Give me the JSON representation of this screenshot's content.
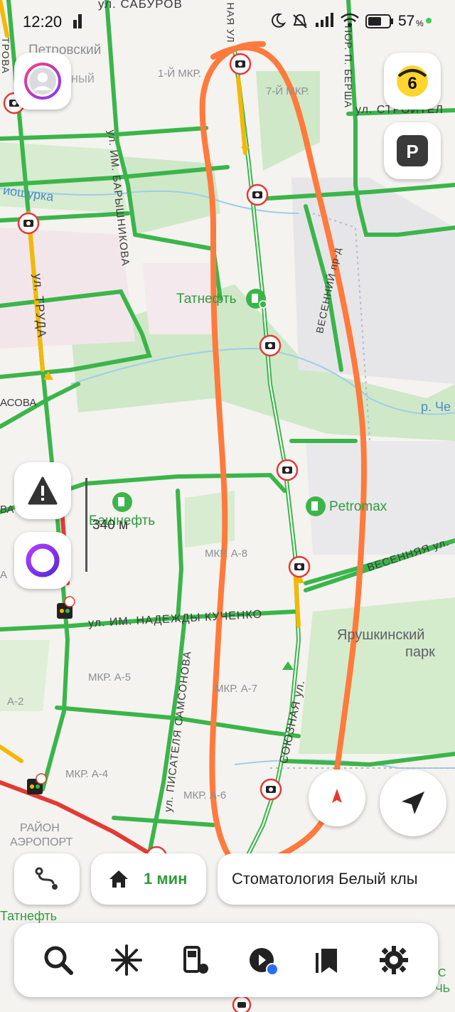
{
  "status_bar": {
    "time": "12:20",
    "battery": "57"
  },
  "weather_badge": {
    "value": "6"
  },
  "scale": {
    "label": "340 м"
  },
  "map_labels": {
    "petrovsky": "Петровский",
    "mkr1": "1-Й МКР.",
    "mkr7": "7-Й МКР.",
    "tatneft_top": "Татнефть",
    "bashneft": "Башнефть",
    "petromax": "Petromax",
    "a8": "МКР. А-8",
    "a5": "МКР. А-5",
    "a7": "МКР. А-7",
    "a4": "МКР. А-4",
    "a6": "МКР. А-6",
    "a2": "А-2",
    "airport_1": "РАЙОН",
    "airport_2": "АЭРОПОРТ",
    "park_1": "Ярушкинский",
    "park_2": "парк",
    "river1": "иошурка",
    "river2": "р. Че",
    "tatneft_bottom": "Татнефть",
    "noisy": "ный",
    "a_left": "А",
    "vsa": "ВА",
    "asova": "АСОВА",
    "s_bottom": "С",
    "ch_bottom": "ЧЬ"
  },
  "streets": {
    "saburova": "ул. САБУРОВ",
    "barshnikova": "ул. ИМ. БАРЫШНИКОВА",
    "truda": "ул. ТРУДА",
    "stroitel": "ул. СТРОИТЕЛ",
    "berсha": "ПОР. П. БЕРША",
    "vesenniy": "ВЕСЕННИЙ пр-д",
    "kuchenko": "ул. ИМ. НАДЕЖДЫ КУЧЕНКО",
    "samsonova": "ул. ПИСАТЕЛЯ САМСОНОВА",
    "soyuznaya": "СОЮЗНАЯ ул.",
    "vesennyaya": "ВЕСЕННЯЯ ул.",
    "naya": "НАЯ УЛ",
    "trova": "ТРОВА"
  },
  "route": {
    "time": "1 мин",
    "destination": "Стоматология Белый клы"
  },
  "colors": {
    "route_highlight": "#ff7a3c",
    "traffic_green": "#3bb54a",
    "traffic_yellow": "#f5b800",
    "traffic_red": "#e53935",
    "accent_yellow": "#ffd52e"
  }
}
